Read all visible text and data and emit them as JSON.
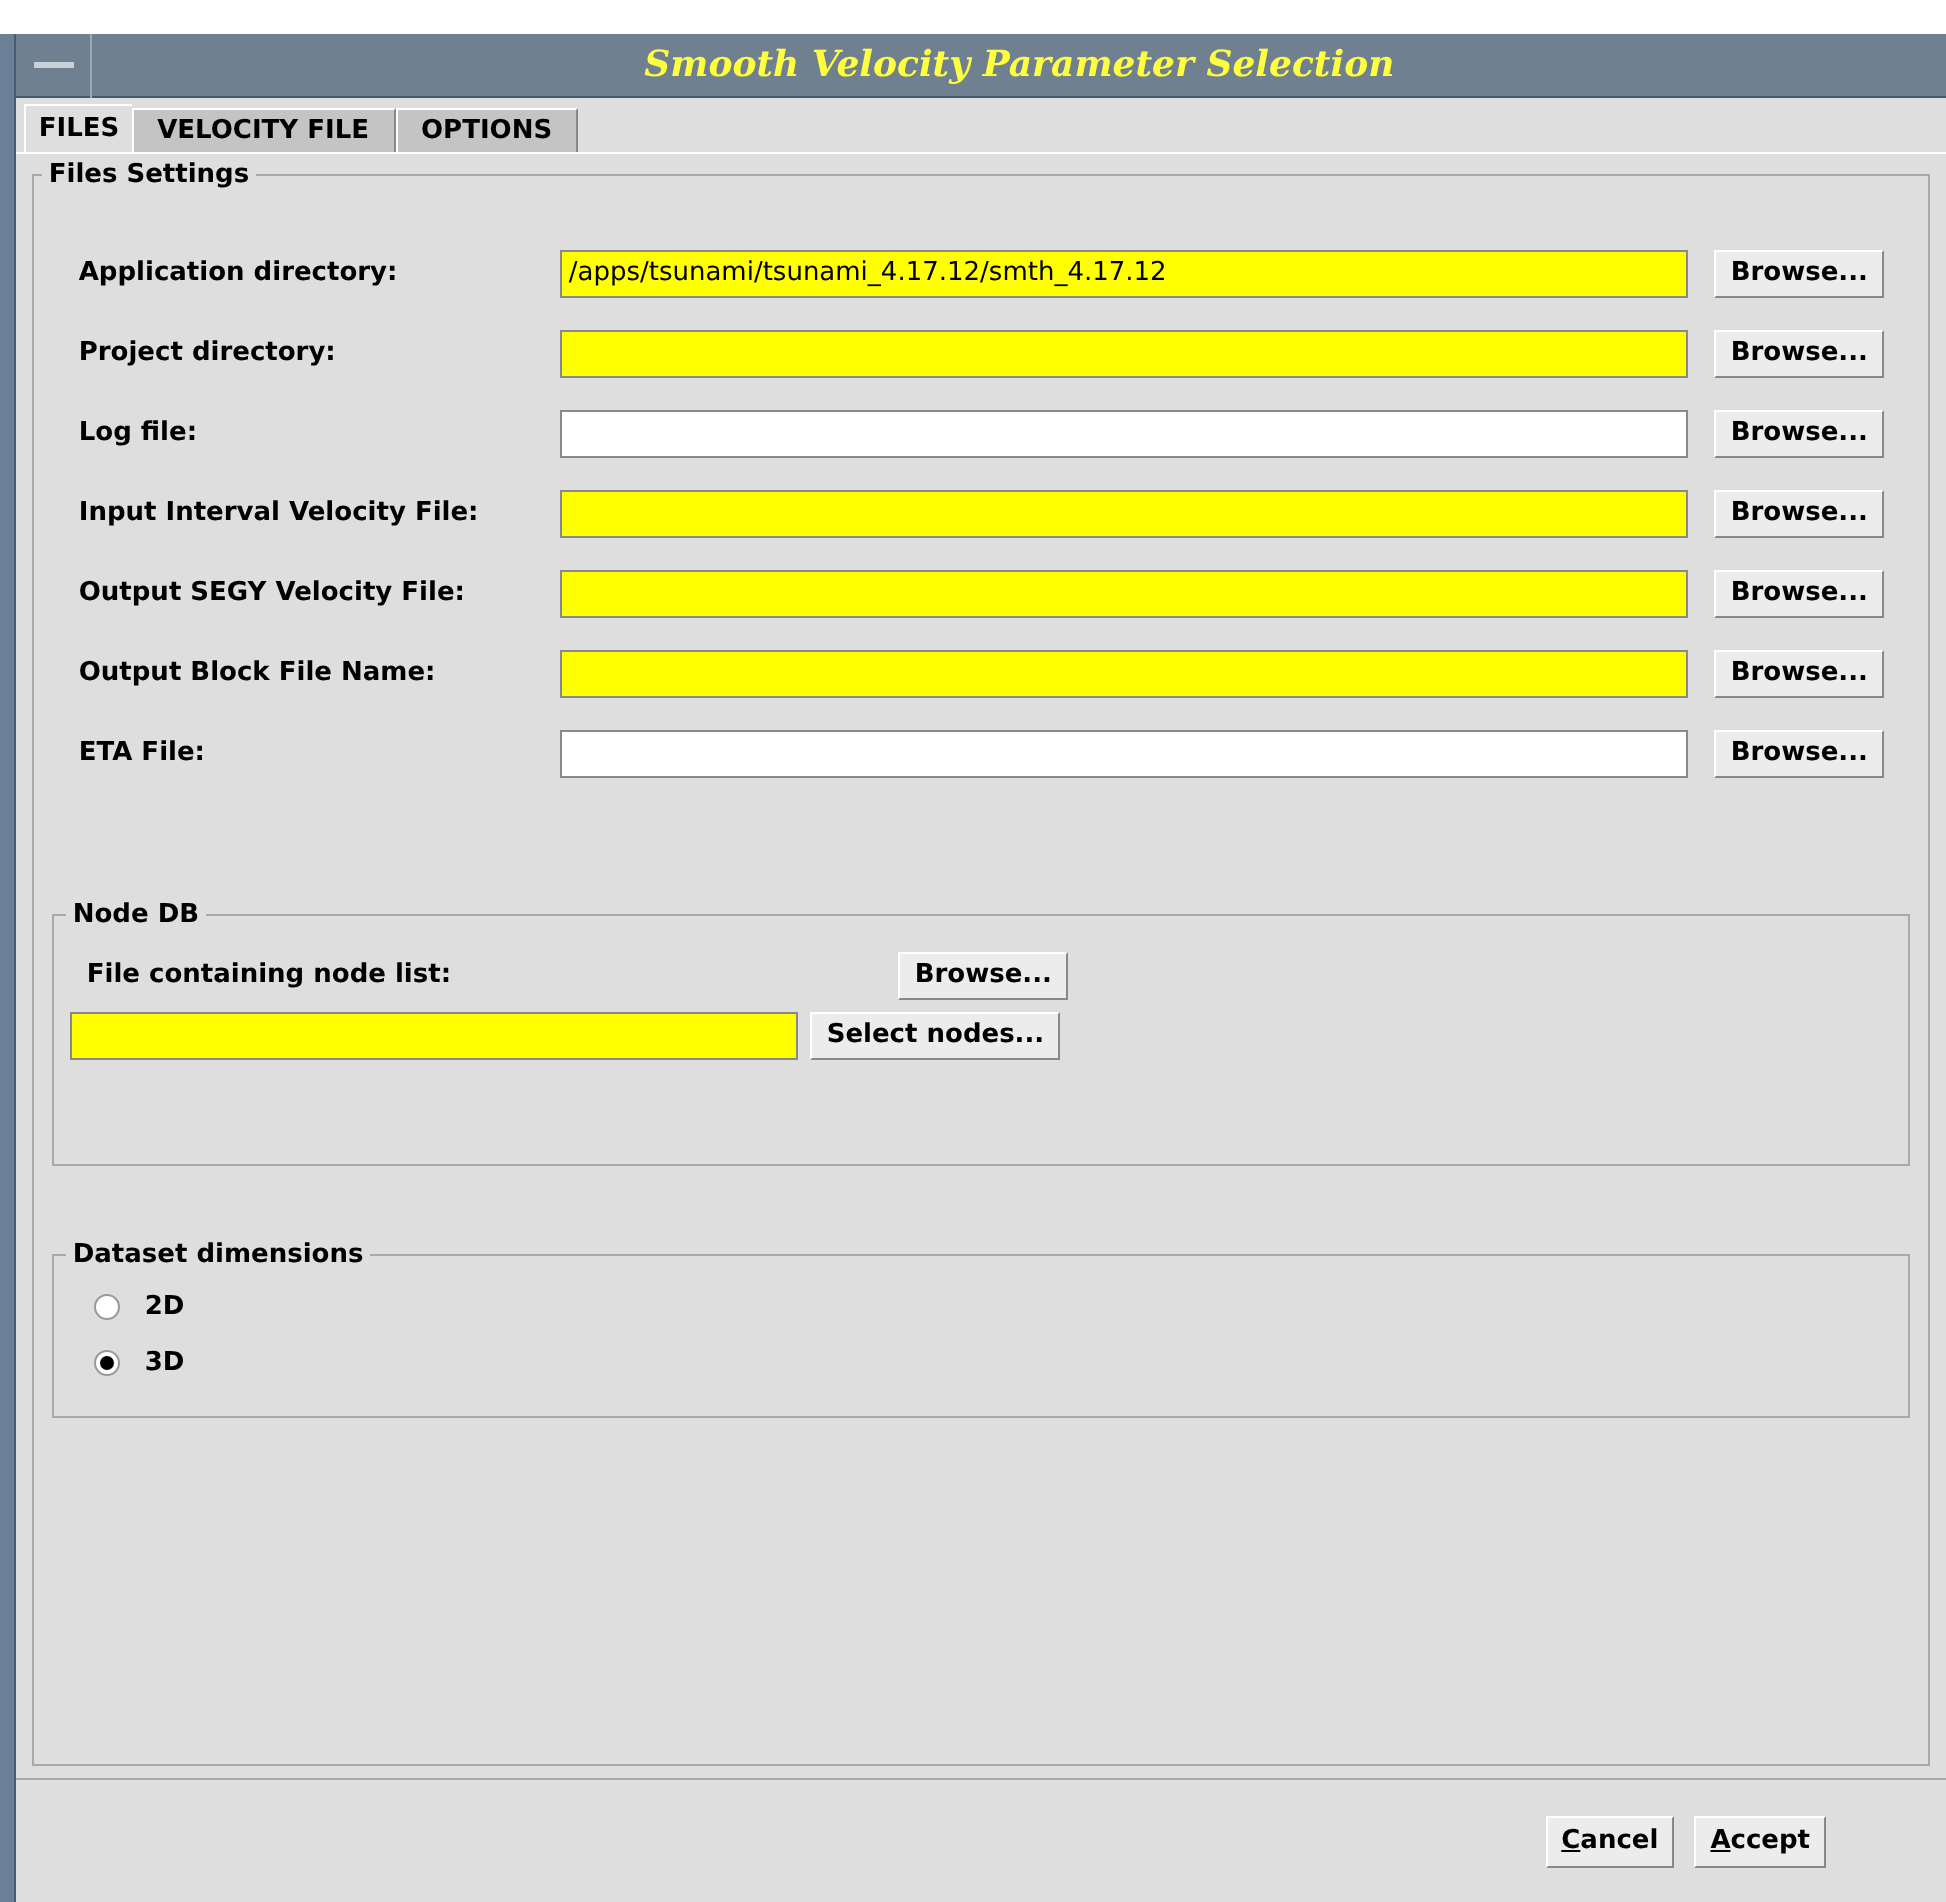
{
  "window": {
    "title": "Smooth Velocity Parameter Selection"
  },
  "tabs": [
    {
      "label": "FILES",
      "selected": true
    },
    {
      "label": "VELOCITY FILE",
      "selected": false
    },
    {
      "label": "OPTIONS",
      "selected": false
    }
  ],
  "files_settings": {
    "title": "Files Settings",
    "rows": [
      {
        "label": "Application directory:",
        "value": "/apps/tsunami/tsunami_4.17.12/smth_4.17.12",
        "required": true,
        "button": "Browse..."
      },
      {
        "label": "Project directory:",
        "required": true,
        "button": "Browse..."
      },
      {
        "label": "Log file:",
        "required": false,
        "button": "Browse..."
      },
      {
        "label": "Input Interval Velocity File:",
        "required": true,
        "button": "Browse..."
      },
      {
        "label": "Output SEGY Velocity File:",
        "required": true,
        "button": "Browse..."
      },
      {
        "label": "Output Block File Name:",
        "required": true,
        "button": "Browse..."
      },
      {
        "label": "ETA File:",
        "required": false,
        "button": "Browse..."
      }
    ]
  },
  "node_db": {
    "title": "Node DB",
    "label": "File containing node list:",
    "browse_button": "Browse...",
    "required": true,
    "select_button": "Select nodes..."
  },
  "dataset_dimensions": {
    "title": "Dataset dimensions",
    "options": [
      {
        "label": "2D",
        "selected": false
      },
      {
        "label": "3D",
        "selected": true
      }
    ]
  },
  "buttons": [
    {
      "label": "Cancel",
      "mnemonic_underlined": true
    },
    {
      "label": "Accept",
      "mnemonic_underlined": true
    }
  ]
}
